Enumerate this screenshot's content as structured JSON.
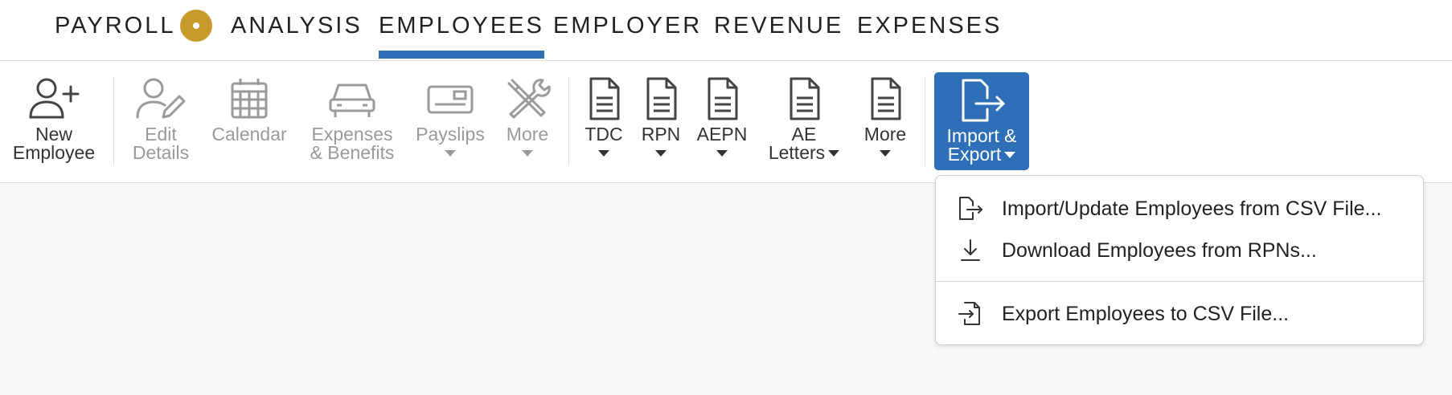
{
  "nav": {
    "items": [
      {
        "label": "PAYROLL",
        "active": false
      },
      {
        "label": "ANALYSIS",
        "active": false
      },
      {
        "label": "EMPLOYEES",
        "active": true
      },
      {
        "label": "EMPLOYER",
        "active": false
      },
      {
        "label": "REVENUE",
        "active": false
      },
      {
        "label": "EXPENSES",
        "active": false
      }
    ],
    "accent_color": "#2f6fb8",
    "badge_color": "#c79a2c"
  },
  "toolbar": {
    "new_employee": {
      "line1": "New",
      "line2": "Employee",
      "icon": "user-plus-icon"
    },
    "edit_details": {
      "line1": "Edit",
      "line2": "Details",
      "icon": "user-edit-icon"
    },
    "calendar": {
      "line1": "Calendar",
      "icon": "calendar-icon"
    },
    "expenses_benefits": {
      "line1": "Expenses",
      "line2": "& Benefits",
      "icon": "car-icon"
    },
    "payslips": {
      "line1": "Payslips",
      "icon": "payslip-icon"
    },
    "more_tools": {
      "line1": "More",
      "icon": "tools-icon"
    },
    "tdc": {
      "line1": "TDC",
      "icon": "document-icon"
    },
    "rpn": {
      "line1": "RPN",
      "icon": "document-icon"
    },
    "aepn": {
      "line1": "AEPN",
      "icon": "document-icon"
    },
    "ae_letters": {
      "line1": "AE",
      "line2": "Letters",
      "icon": "document-icon"
    },
    "more_docs": {
      "line1": "More",
      "icon": "document-icon"
    },
    "import_export": {
      "line1": "Import &",
      "line2": "Export",
      "icon": "file-export-icon"
    }
  },
  "dropdown": {
    "items": [
      {
        "label": "Import/Update Employees from CSV File...",
        "icon": "file-import-icon"
      },
      {
        "label": "Download Employees from RPNs...",
        "icon": "download-icon"
      },
      {
        "label": "Export Employees to CSV File...",
        "icon": "file-export-icon"
      }
    ]
  }
}
